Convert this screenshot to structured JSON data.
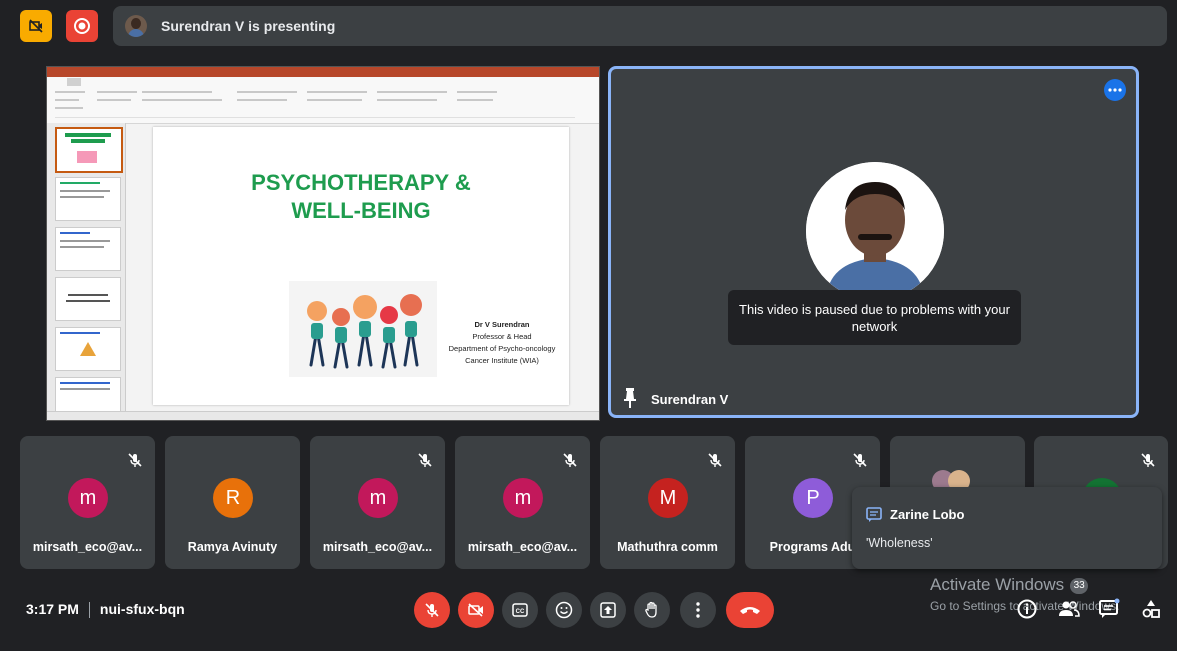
{
  "top_bar": {
    "presenting_text": "Surendran V is presenting",
    "accent_yellow": "#f9ab00",
    "accent_red": "#ea4335"
  },
  "slide": {
    "title_line1": "PSYCHOTHERAPY &",
    "title_line2": "WELL-BEING",
    "author_name": "Dr V Surendran",
    "author_role": "Professor & Head",
    "author_dept": "Department of Psycho-oncology",
    "author_inst": "Cancer Institute (WIA)"
  },
  "speaker": {
    "name": "Surendran V",
    "paused_message": "This video is paused due to problems with your network"
  },
  "participants": [
    {
      "initial": "m",
      "name": "mirsath_eco@av...",
      "color": "#c2185b"
    },
    {
      "initial": "R",
      "name": "Ramya Avinuty",
      "color": "#e8710a"
    },
    {
      "initial": "m",
      "name": "mirsath_eco@av...",
      "color": "#c2185b"
    },
    {
      "initial": "m",
      "name": "mirsath_eco@av...",
      "color": "#c2185b"
    },
    {
      "initial": "M",
      "name": "Mathuthra comm",
      "color": "#c5221f"
    },
    {
      "initial": "P",
      "name": "Programs Adu",
      "color": "#8e5cd9"
    }
  ],
  "chat_toast": {
    "sender": "Zarine Lobo",
    "message": "'Wholeness'"
  },
  "bottom_bar": {
    "time": "3:17 PM",
    "meeting_code": "nui-sfux-bqn",
    "activate_title": "Activate Windows",
    "activate_sub": "Go to Settings to activate Windows.",
    "participant_count": "33"
  }
}
